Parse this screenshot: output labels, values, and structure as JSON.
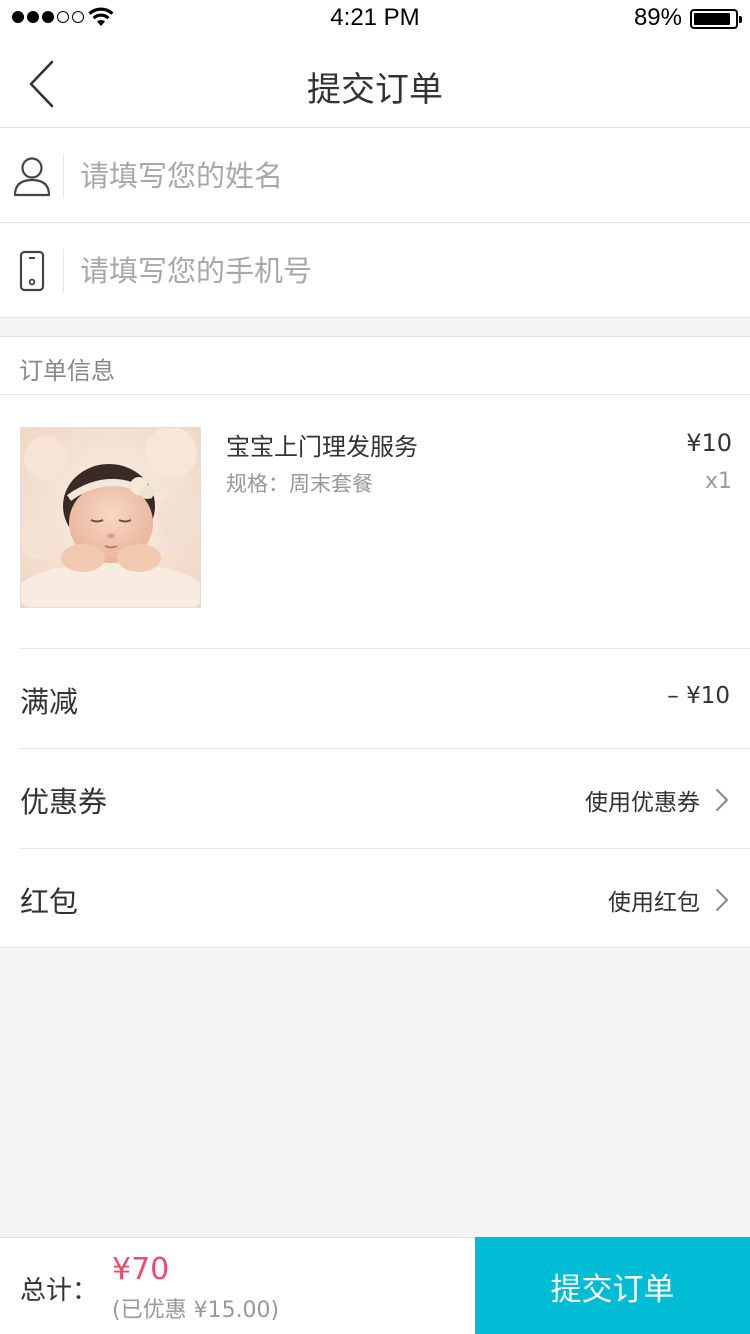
{
  "status_bar": {
    "time": "4:21 PM",
    "battery_percent": "89%",
    "battery_level": 0.89,
    "signal_bars_filled": 3,
    "signal_bars_total": 5
  },
  "nav": {
    "title": "提交订单",
    "back_icon": "chevron-left-icon"
  },
  "form": {
    "name_placeholder": "请填写您的姓名",
    "name_icon": "user-icon",
    "phone_placeholder": "请填写您的手机号",
    "phone_icon": "phone-icon"
  },
  "order_info": {
    "header": "订单信息",
    "product": {
      "name": "宝宝上门理发服务",
      "spec": "规格：周末套餐",
      "price": "¥10",
      "quantity": "x1"
    }
  },
  "discounts": [
    {
      "label": "满减",
      "value": "– ¥10",
      "chevron": false
    },
    {
      "label": "优惠券",
      "value": "使用优惠券",
      "chevron": true
    },
    {
      "label": "红包",
      "value": "使用红包",
      "chevron": true
    }
  ],
  "footer": {
    "total_label": "总计：",
    "total_amount": "¥70",
    "saved_text": "(已优惠 ¥15.00)",
    "submit_label": "提交订单"
  },
  "colors": {
    "accent": "#00bcd4",
    "price_red": "#f04a68"
  }
}
